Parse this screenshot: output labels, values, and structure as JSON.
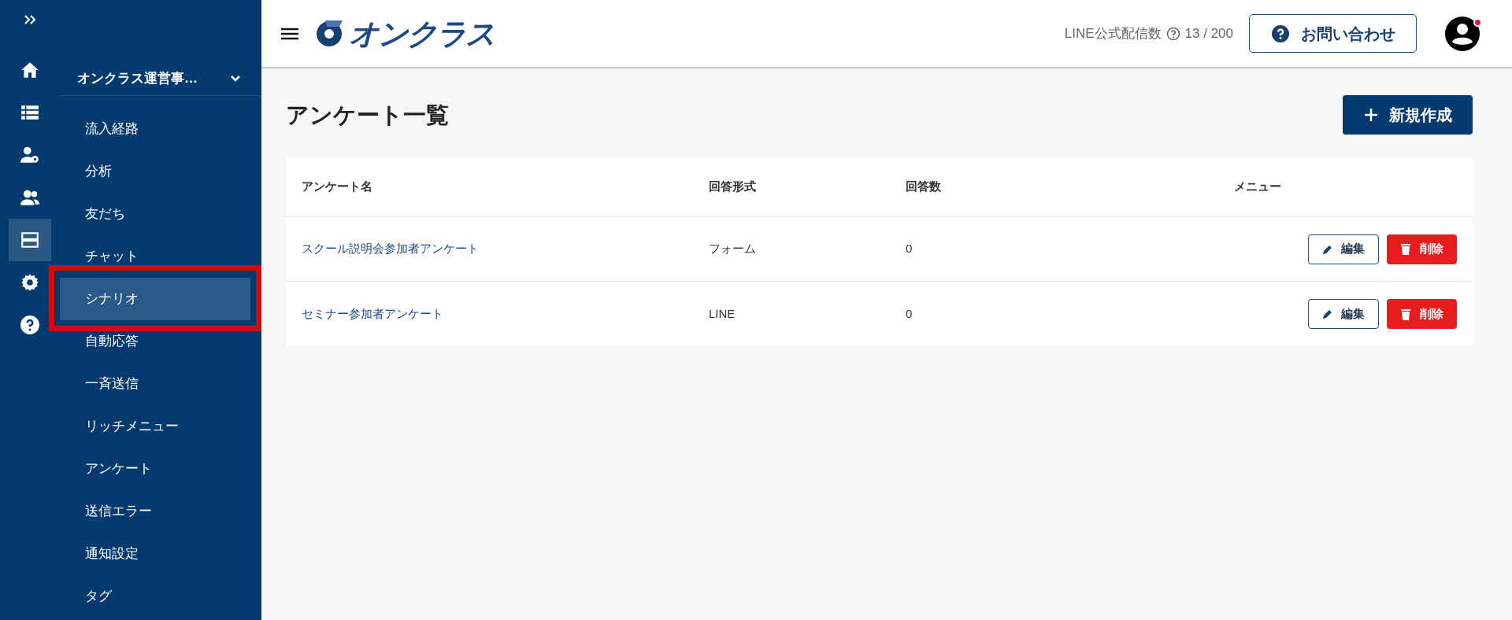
{
  "rail": {
    "items": [
      {
        "kind": "home",
        "selected": false
      },
      {
        "kind": "list",
        "selected": false
      },
      {
        "kind": "user-gear",
        "selected": false
      },
      {
        "kind": "users",
        "selected": false
      },
      {
        "kind": "rows",
        "selected": true
      },
      {
        "kind": "gear",
        "selected": false
      },
      {
        "kind": "help",
        "selected": false
      }
    ]
  },
  "sidebar": {
    "account": "オンクラス運営事…",
    "items": [
      {
        "label": "流入経路",
        "selected": false
      },
      {
        "label": "分析",
        "selected": false
      },
      {
        "label": "友だち",
        "selected": false
      },
      {
        "label": "チャット",
        "selected": false
      },
      {
        "label": "シナリオ",
        "selected": true
      },
      {
        "label": "自動応答",
        "selected": false
      },
      {
        "label": "一斉送信",
        "selected": false
      },
      {
        "label": "リッチメニュー",
        "selected": false
      },
      {
        "label": "アンケート",
        "selected": false
      },
      {
        "label": "送信エラー",
        "selected": false
      },
      {
        "label": "通知設定",
        "selected": false
      },
      {
        "label": "タグ",
        "selected": false
      }
    ]
  },
  "header": {
    "logo": "オンクラス",
    "quota_label": "LINE公式配信数",
    "quota": "13 / 200",
    "contact_button": "お問い合わせ",
    "notification": true
  },
  "page": {
    "title": "アンケート一覧",
    "new_button": "新規作成"
  },
  "table": {
    "columns": [
      "アンケート名",
      "回答形式",
      "回答数",
      "メニュー"
    ],
    "rows": [
      {
        "name": "スクール説明会参加者アンケート",
        "format": "フォーム",
        "answers": "0",
        "edit": "編集",
        "delete": "削除"
      },
      {
        "name": "セミナー参加者アンケート",
        "format": "LINE",
        "answers": "0",
        "edit": "編集",
        "delete": "削除"
      }
    ]
  }
}
